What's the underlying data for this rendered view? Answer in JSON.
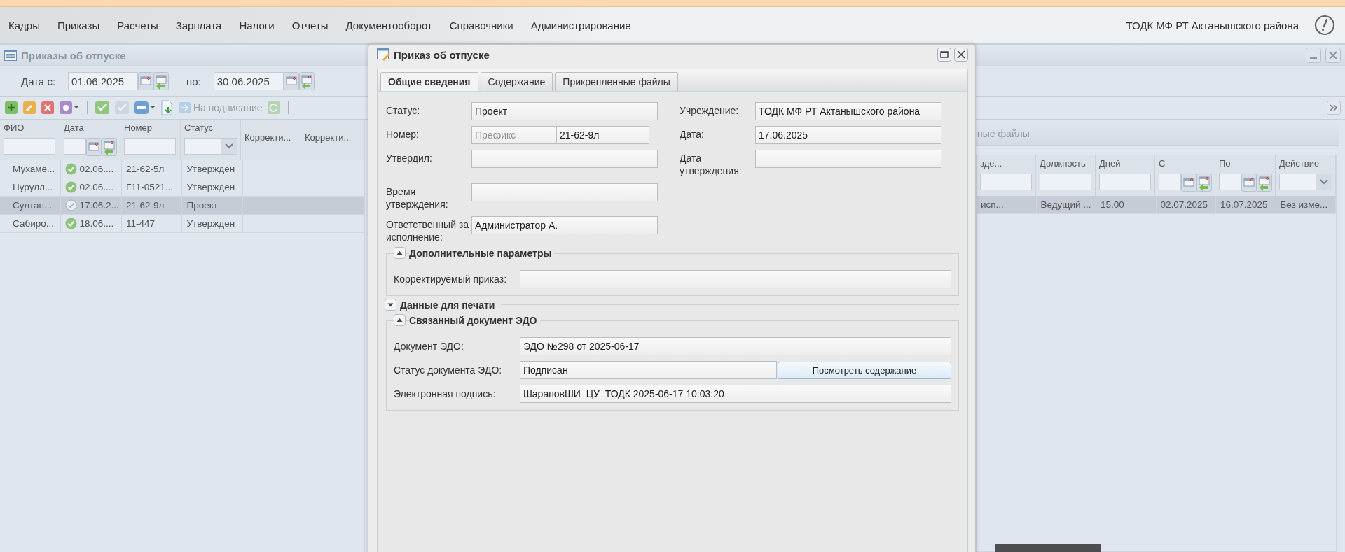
{
  "menu": {
    "items": [
      "Кадры",
      "Приказы",
      "Расчеты",
      "Зарплата",
      "Налоги",
      "Отчеты",
      "Документооборот",
      "Справочники",
      "Администрирование"
    ],
    "organization": "ТОДК МФ РТ Актанышского района"
  },
  "list_window": {
    "title": "Приказы об отпуске",
    "date_from_label": "Дата с:",
    "date_from": "01.06.2025",
    "date_to_label": "по:",
    "date_to": "30.06.2025",
    "toolbar": [
      {
        "kind": "add",
        "disabled": false
      },
      {
        "kind": "edit",
        "disabled": false
      },
      {
        "kind": "delete",
        "disabled": false
      },
      {
        "kind": "settings",
        "disabled": false
      },
      {
        "kind": "separator"
      },
      {
        "kind": "approve",
        "disabled": false
      },
      {
        "kind": "unapprove",
        "disabled": true
      },
      {
        "kind": "print",
        "disabled": false
      },
      {
        "kind": "export",
        "disabled": false
      },
      {
        "kind": "sign",
        "label": "На подписание",
        "disabled": true
      },
      {
        "kind": "refresh",
        "disabled": true
      },
      {
        "kind": "separator"
      }
    ],
    "table": {
      "columns": [
        {
          "label": "ФИО",
          "kind": "text"
        },
        {
          "label": "Дата",
          "kind": "date"
        },
        {
          "label": "Номер",
          "kind": "text"
        },
        {
          "label": "Статус",
          "kind": "combo"
        },
        {
          "label": "Корректи...",
          "kind": "plain"
        },
        {
          "label": "Корректи...",
          "kind": "plain"
        }
      ],
      "rows": [
        {
          "cells": [
            "Мухаме...",
            "02.06....",
            "21-62-5л",
            "Утвержден"
          ],
          "approved": true,
          "selected": false
        },
        {
          "cells": [
            "Нурулл...",
            "02.06....",
            "Г11-0521...",
            "Утвержден"
          ],
          "approved": true,
          "selected": false
        },
        {
          "cells": [
            "Султан...",
            "17.06.2...",
            "21-62-9л",
            "Проект"
          ],
          "approved": false,
          "selected": true
        },
        {
          "cells": [
            "Сабиро...",
            "18.06....",
            "11-447",
            "Утвержден"
          ],
          "approved": true,
          "selected": false
        }
      ]
    },
    "detail": {
      "tab": "ные файлы",
      "table": {
        "columns": [
          {
            "label": "зде...",
            "kind": "text"
          },
          {
            "label": "Должность",
            "kind": "text"
          },
          {
            "label": "Дней",
            "kind": "text"
          },
          {
            "label": "С",
            "kind": "date"
          },
          {
            "label": "По",
            "kind": "date"
          },
          {
            "label": "Действие",
            "kind": "combo"
          }
        ],
        "rows": [
          {
            "cells": [
              "исп...",
              "Ведущий ...",
              "15.00",
              "02.07.2025",
              "16.07.2025",
              "Без изме..."
            ],
            "selected": true
          }
        ]
      }
    }
  },
  "dialog": {
    "title": "Приказ об отпуске",
    "tabs": [
      {
        "label": "Общие сведения",
        "selected": true
      },
      {
        "label": "Содержание",
        "selected": false
      },
      {
        "label": "Прикрепленные файлы",
        "selected": false
      }
    ],
    "left_fields": [
      {
        "label": "Статус:",
        "value": "Проект"
      },
      {
        "label": "Номер:",
        "prefix_placeholder": "Префикс",
        "value": "21-62-9л"
      },
      {
        "label": "Утвердил:"
      },
      {
        "label": "Время утверждения:"
      },
      {
        "label": "Ответственный за исполнение:",
        "value": "Администратор А."
      }
    ],
    "right_fields": [
      {
        "label": "Учреждение:",
        "value": "ТОДК МФ РТ Актанышского района"
      },
      {
        "label": "Дата:",
        "value": "17.06.2025"
      },
      {
        "label": "Дата утверждения:"
      }
    ],
    "sections": [
      {
        "title": "Дополнительные параметры",
        "expanded": true,
        "fields": [
          {
            "label": "Корректируемый приказ:"
          }
        ]
      },
      {
        "title": "Данные для печати",
        "expanded": false
      },
      {
        "title": "Связанный документ ЭДО",
        "expanded": true,
        "fields": [
          {
            "label": "Документ ЭДО:",
            "value": "ЭДО №298 от 2025-06-17"
          },
          {
            "label": "Статус документа ЭДО:",
            "value": "Подписан",
            "button": "Посмотреть содержание"
          },
          {
            "label": "Электронная подпись:",
            "value": "ШараповШИ_ЦУ_ТОДК 2025-06-17 10:03:20"
          }
        ]
      }
    ]
  }
}
